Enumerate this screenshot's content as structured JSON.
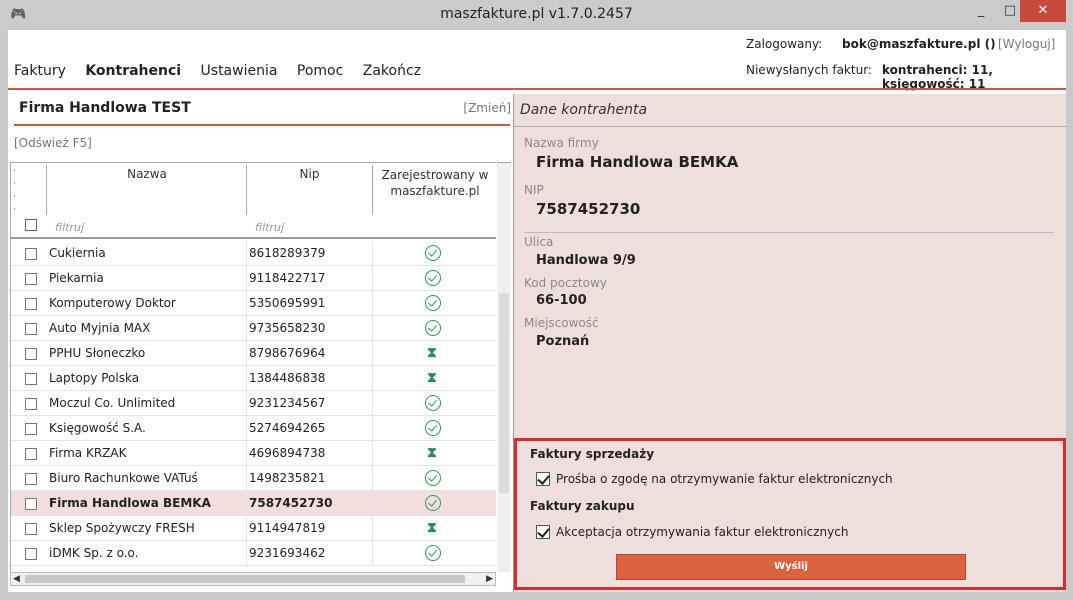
{
  "window": {
    "title": "maszfakture.pl  v1.7.0.2457",
    "min": "_",
    "max": "□",
    "close": "✕"
  },
  "header": {
    "login_label": "Zalogowany:",
    "login_email": "bok@maszfakture.pl ()",
    "logout": "[Wyloguj]",
    "pending_label": "Niewysłanych faktur:",
    "pending_value": "kontrahenci: 11, księgowość: 11"
  },
  "menu": [
    {
      "label": "Faktury"
    },
    {
      "label": "Kontrahenci"
    },
    {
      "label": "Ustawienia"
    },
    {
      "label": "Pomoc"
    },
    {
      "label": "Zakończ"
    }
  ],
  "left": {
    "company": "Firma Handlowa TEST",
    "change": "[Zmień]",
    "refresh": "[Odśwież F5]",
    "columns": {
      "name": "Nazwa",
      "nip": "Nip",
      "registered_line1": "Zarejestrowany w",
      "registered_line2": "maszfakture.pl"
    },
    "filter_placeholder": "filtruj",
    "rows": [
      {
        "name": "Cukiernia",
        "nip": "8618289379",
        "status": "ok"
      },
      {
        "name": "Piekarnia",
        "nip": "9118422717",
        "status": "ok"
      },
      {
        "name": "Komputerowy Doktor",
        "nip": "5350695991",
        "status": "ok"
      },
      {
        "name": "Auto Myjnia MAX",
        "nip": "9735658230",
        "status": "ok"
      },
      {
        "name": "PPHU Słoneczko",
        "nip": "8798676964",
        "status": "wait"
      },
      {
        "name": "Laptopy Polska",
        "nip": "1384486838",
        "status": "wait"
      },
      {
        "name": "Moczul Co. Unlimited",
        "nip": "9231234567",
        "status": "ok"
      },
      {
        "name": "Księgowość S.A.",
        "nip": "5274694265",
        "status": "ok"
      },
      {
        "name": "Firma KRZAK",
        "nip": "4696894738",
        "status": "wait"
      },
      {
        "name": "Biuro Rachunkowe VATuś",
        "nip": "1498235821",
        "status": "ok"
      },
      {
        "name": "Firma Handlowa BEMKA",
        "nip": "7587452730",
        "status": "ok",
        "selected": true
      },
      {
        "name": "Sklep Spożywczy FRESH",
        "nip": "9114947819",
        "status": "wait"
      },
      {
        "name": "iDMK Sp. z o.o.",
        "nip": "9231693462",
        "status": "ok"
      }
    ]
  },
  "right": {
    "title": "Dane kontrahenta",
    "company_label": "Nazwa firmy",
    "company_value": "Firma Handlowa BEMKA",
    "nip_label": "NIP",
    "nip_value": "7587452730",
    "street_label": "Ulica",
    "street_value": "Handlowa 9/9",
    "postal_label": "Kod pocztowy",
    "postal_value": "66-100",
    "city_label": "Miejscowość",
    "city_value": "Poznań",
    "sales_heading": "Faktury sprzedaży",
    "sales_option": "Prośba o zgodę na otrzymywanie faktur elektronicznych",
    "purchase_heading": "Faktury zakupu",
    "purchase_option": "Akceptacja otrzymywania faktur elektronicznych",
    "send_button": "Wyślij"
  },
  "colors": {
    "accent": "#d9533f",
    "highlight": "#d92b2b",
    "status_ok": "#2e9b4e"
  }
}
